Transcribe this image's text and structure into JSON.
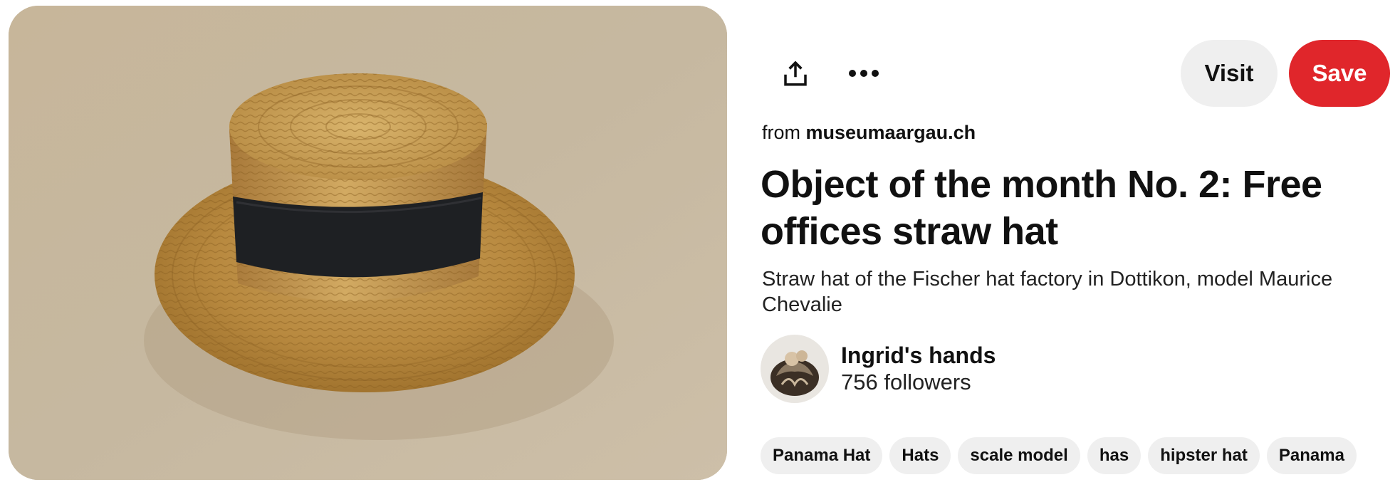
{
  "pin": {
    "image_alt": "Straw hat with black band",
    "source_prefix": "from",
    "source_domain": "museumaargau.ch",
    "title": "Object of the month No. 2: Free offices straw hat",
    "description": "Straw hat of the Fischer hat factory in Dottikon, model Maurice Chevalie"
  },
  "actions": {
    "share_icon": "share-icon",
    "more_icon": "more-options-icon",
    "visit_label": "Visit",
    "save_label": "Save"
  },
  "creator": {
    "name": "Ingrid's hands",
    "followers": "756 followers"
  },
  "tags": [
    "Panama Hat",
    "Hats",
    "scale model",
    "has",
    "hipster hat",
    "Panama"
  ],
  "colors": {
    "save": "#e0262b",
    "visit": "#efefef",
    "tag": "#efefef",
    "text": "#111111"
  }
}
